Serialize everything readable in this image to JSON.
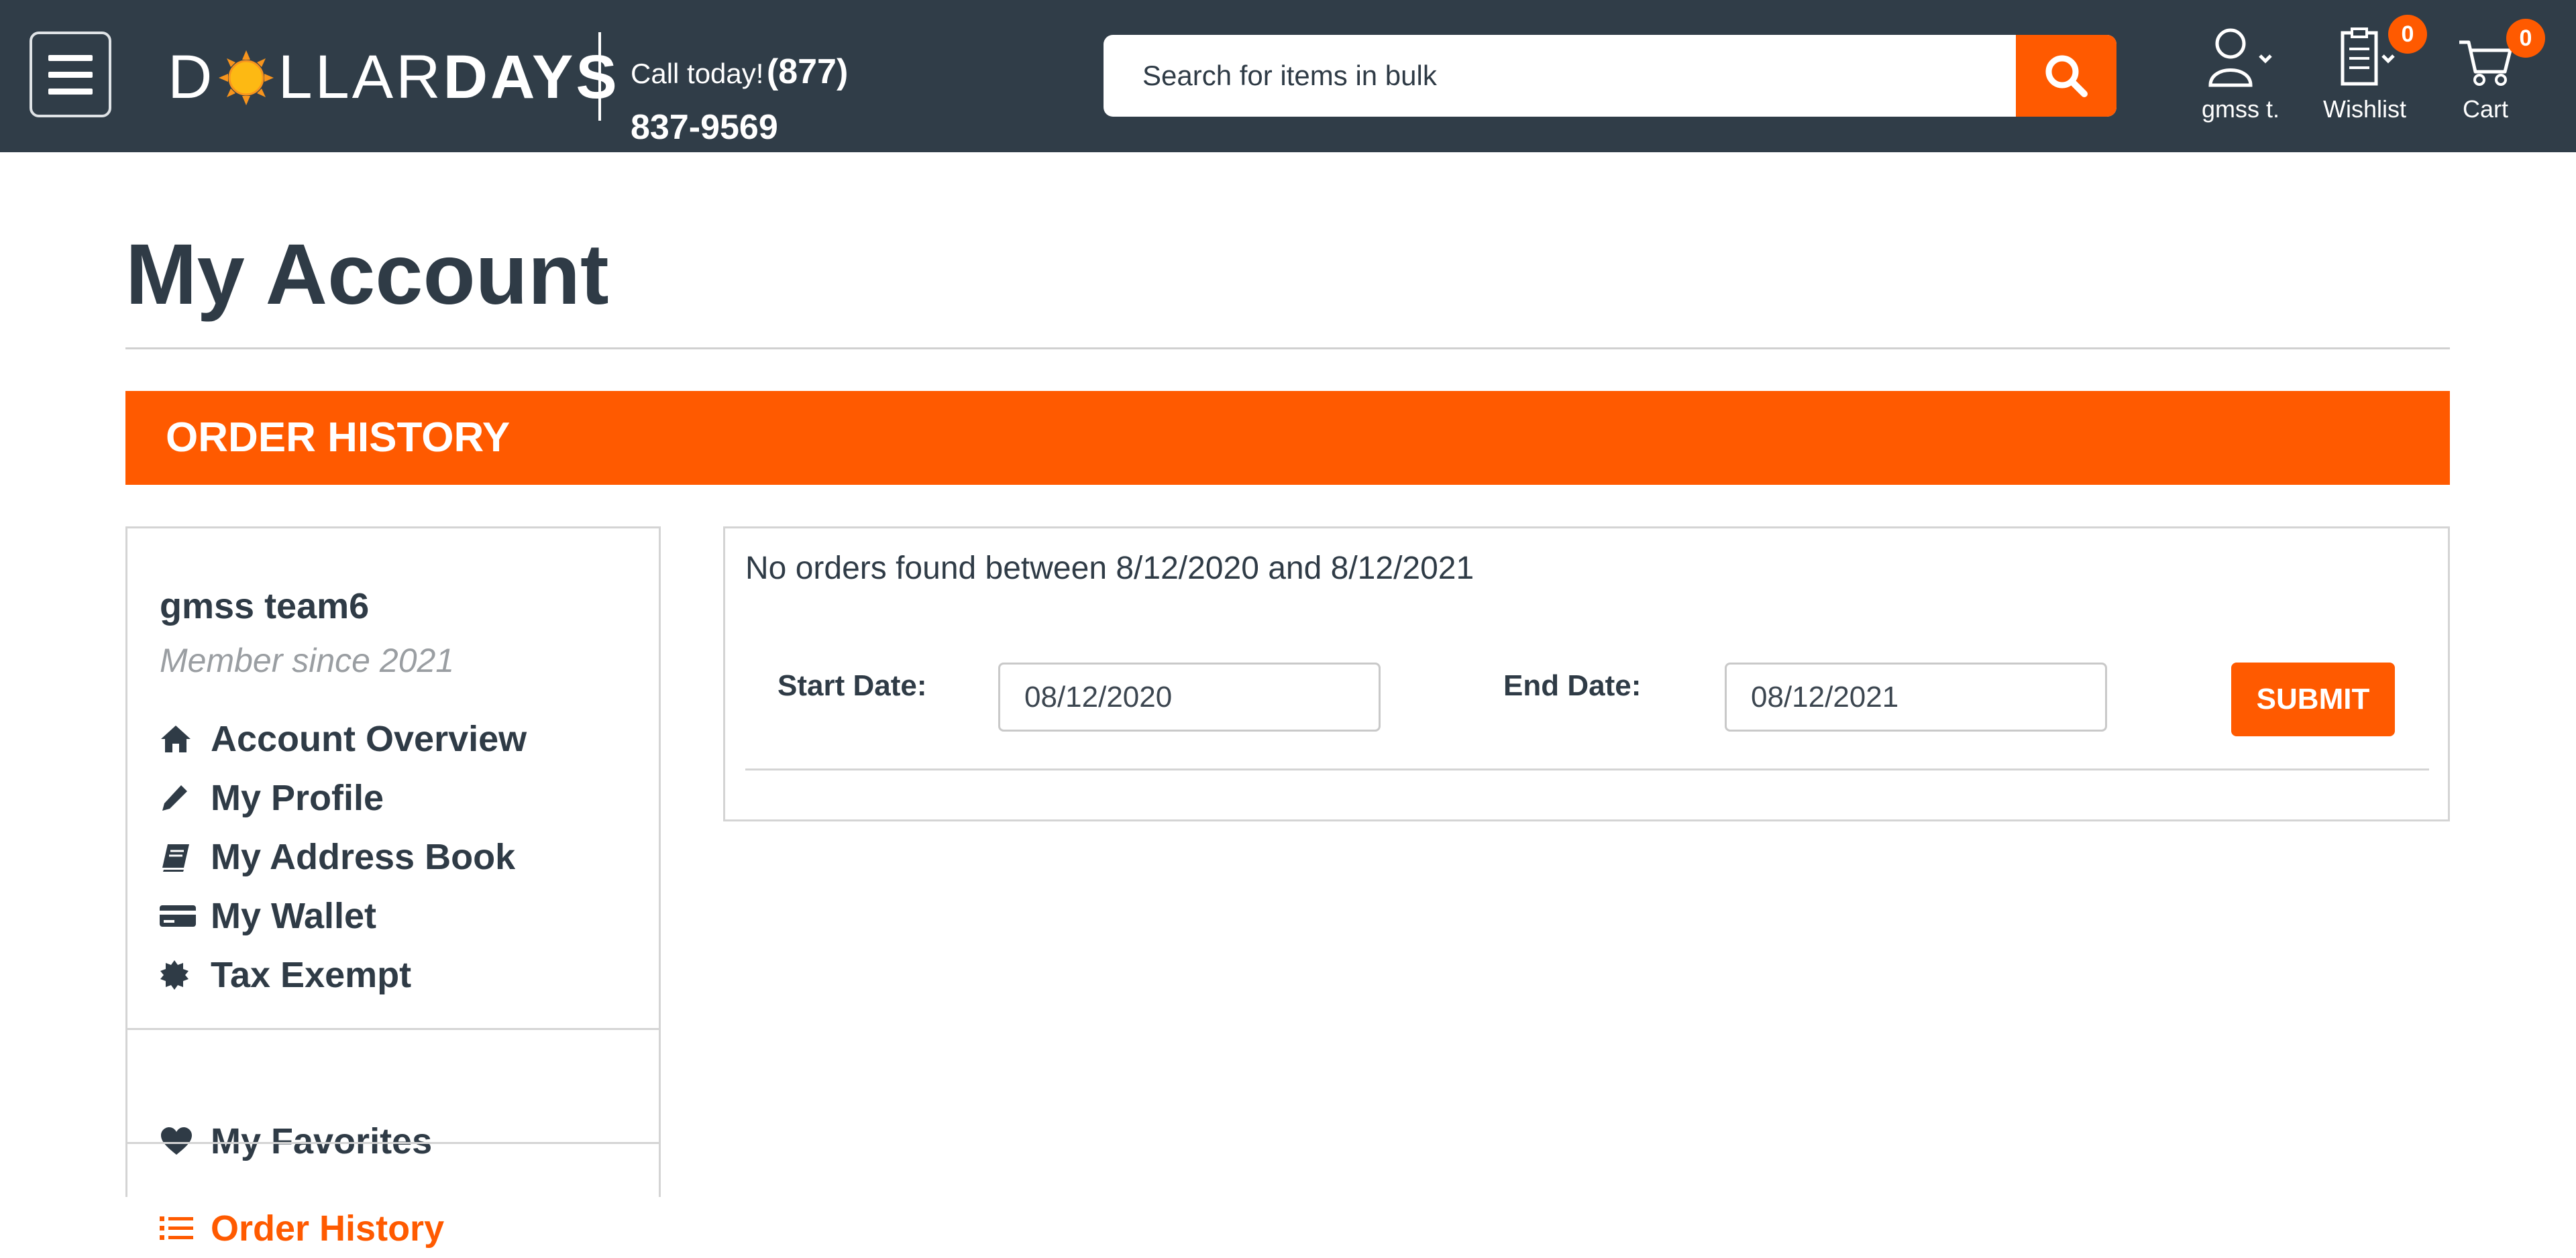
{
  "header": {
    "logo": {
      "part1": "D",
      "part2": "LLAR",
      "part3": "DAYS"
    },
    "call_label": "Call today!",
    "phone_part1": "(877)",
    "phone_part2": "837-9569",
    "search": {
      "placeholder": "Search for items in bulk",
      "value": ""
    },
    "account_label": "gmss t.",
    "wishlist_label": "Wishlist",
    "wishlist_count": "0",
    "cart_label": "Cart",
    "cart_count": "0"
  },
  "page": {
    "title": "My Account",
    "section_title": "ORDER HISTORY"
  },
  "sidebar": {
    "user_name": "gmss team6",
    "member_since": "Member since 2021",
    "items": [
      {
        "label": "Account Overview",
        "icon": "home-icon"
      },
      {
        "label": "My Profile",
        "icon": "pencil-icon"
      },
      {
        "label": "My Address Book",
        "icon": "book-icon"
      },
      {
        "label": "My Wallet",
        "icon": "credit-card-icon"
      },
      {
        "label": "Tax Exempt",
        "icon": "certificate-icon"
      }
    ],
    "favorites_label": "My Favorites",
    "order_history_label": "Order History"
  },
  "orders": {
    "message": "No orders found between 8/12/2020 and 8/12/2021",
    "start_label": "Start Date:",
    "start_value": "08/12/2020",
    "end_label": "End Date:",
    "end_value": "08/12/2021",
    "submit_label": "SUBMIT"
  },
  "colors": {
    "header_bg": "#303d48",
    "accent": "#ff5a00",
    "text": "#2f3b46"
  }
}
